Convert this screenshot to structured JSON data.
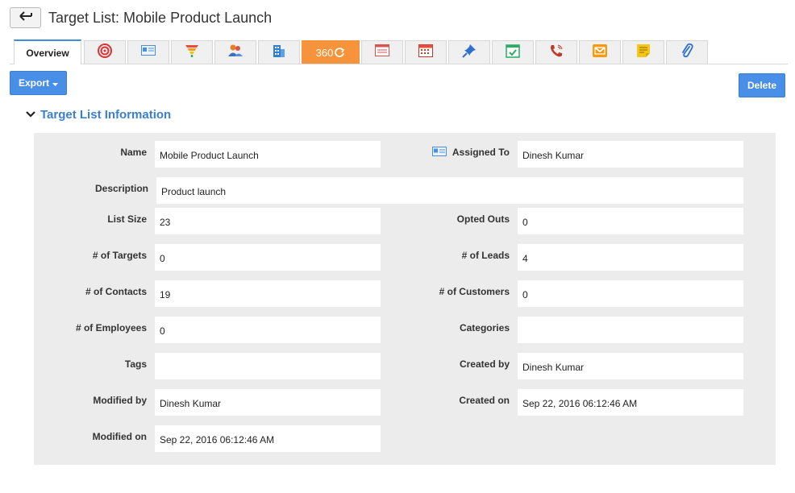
{
  "header": {
    "title": "Target List: Mobile Product Launch"
  },
  "tabs": {
    "overview_label": "Overview",
    "t360_label": "360",
    "icons": [
      "target-icon",
      "card-icon",
      "funnel-icon",
      "contacts-icon",
      "building-icon",
      "360-icon",
      "list-icon",
      "calendar-icon",
      "pin-icon",
      "task-icon",
      "phone-icon",
      "mail-icon",
      "note-icon",
      "attachment-icon"
    ]
  },
  "toolbar": {
    "export_label": "Export",
    "delete_label": "Delete"
  },
  "section": {
    "title": "Target List Information"
  },
  "fields": {
    "name": {
      "label": "Name",
      "value": "Mobile Product Launch"
    },
    "assigned_to": {
      "label": "Assigned To",
      "value": "Dinesh Kumar"
    },
    "description": {
      "label": "Description",
      "value": "Product launch"
    },
    "list_size": {
      "label": "List Size",
      "value": "23"
    },
    "opted_outs": {
      "label": "Opted Outs",
      "value": "0"
    },
    "targets": {
      "label": "# of Targets",
      "value": "0"
    },
    "leads": {
      "label": "# of Leads",
      "value": "4"
    },
    "contacts": {
      "label": "# of Contacts",
      "value": "19"
    },
    "customers": {
      "label": "# of Customers",
      "value": "0"
    },
    "employees": {
      "label": "# of Employees",
      "value": "0"
    },
    "categories": {
      "label": "Categories",
      "value": ""
    },
    "tags": {
      "label": "Tags",
      "value": ""
    },
    "created_by": {
      "label": "Created by",
      "value": "Dinesh Kumar"
    },
    "modified_by": {
      "label": "Modified by",
      "value": "Dinesh Kumar"
    },
    "created_on": {
      "label": "Created on",
      "value": "Sep 22, 2016 06:12:46 AM"
    },
    "modified_on": {
      "label": "Modified on",
      "value": "Sep 22, 2016 06:12:46 AM"
    }
  },
  "colors": {
    "accent": "#4a8fe7",
    "tab_360": "#f7933a",
    "panel_bg": "#ececec",
    "section_title": "#3b7fcf"
  }
}
